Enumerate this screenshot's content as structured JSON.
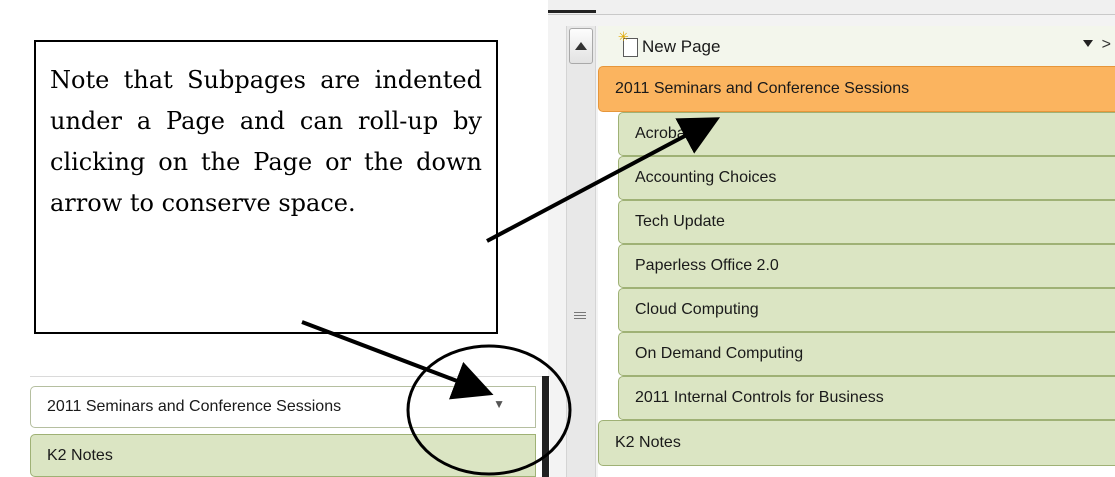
{
  "pages_pane": {
    "new_page_label": "New Page",
    "items": [
      {
        "label": "2011 Seminars and Conference Sessions",
        "level": "page",
        "selected": true
      },
      {
        "label": "Acrobat X",
        "level": "subpage"
      },
      {
        "label": "Accounting Choices",
        "level": "subpage"
      },
      {
        "label": "Tech Update",
        "level": "subpage"
      },
      {
        "label": "Paperless Office 2.0",
        "level": "subpage"
      },
      {
        "label": "Cloud Computing",
        "level": "subpage"
      },
      {
        "label": "On Demand Computing",
        "level": "subpage"
      },
      {
        "label": "2011 Internal Controls for Business",
        "level": "subpage"
      },
      {
        "label": "K2 Notes",
        "level": "page"
      }
    ]
  },
  "collapsed_pane": {
    "items": [
      {
        "label": "2011 Seminars and Conference Sessions",
        "collapse_icon": "chevron-down-icon"
      },
      {
        "label": "K2 Notes"
      }
    ]
  },
  "callout": {
    "text": "Note that Subpages are indented under a Page and can roll-up by clicking on the Page or the down arrow to conserve space."
  },
  "colors": {
    "tab_green": "#dbe5c3",
    "tab_border": "#9fb175",
    "tab_selected": "#fbb45f",
    "annotation": "#000000"
  }
}
